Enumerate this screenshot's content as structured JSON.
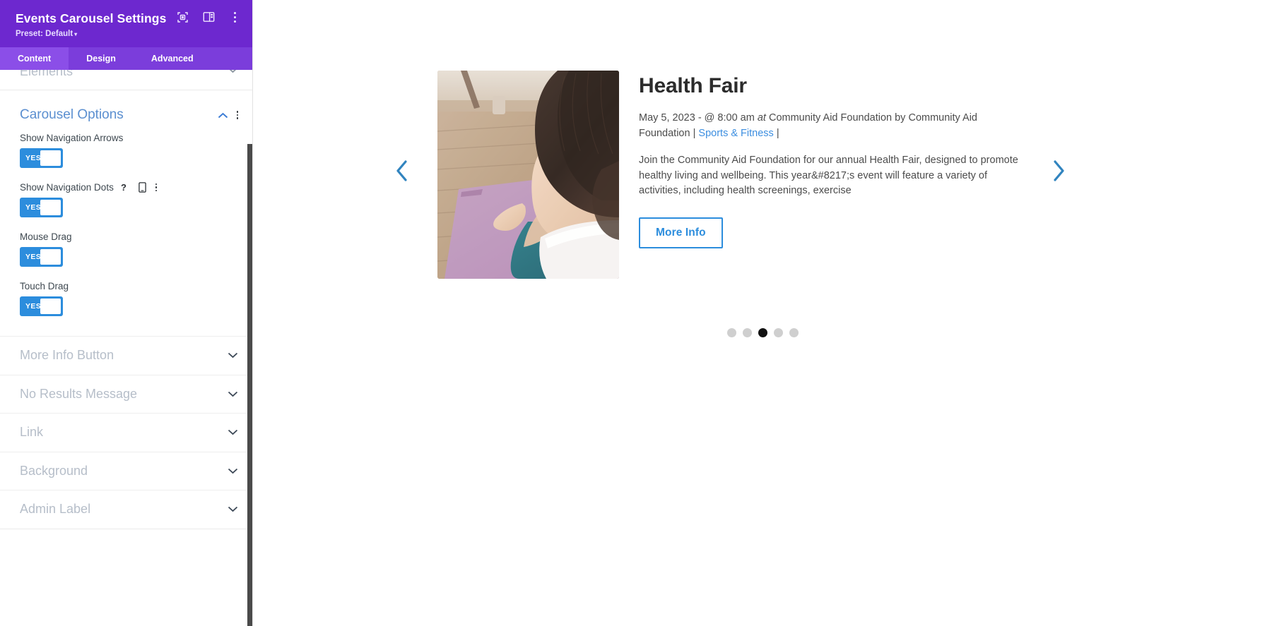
{
  "panel": {
    "title": "Events Carousel Settings",
    "preset_label": "Preset: Default",
    "preset_caret": "▾",
    "header_icons": [
      {
        "name": "focus-target-icon",
        "label": "Focus"
      },
      {
        "name": "layout-columns-icon",
        "label": "Layout"
      },
      {
        "name": "more-options-icon",
        "label": "More options"
      }
    ],
    "tabs": [
      {
        "label": "Content",
        "active": true
      },
      {
        "label": "Design",
        "active": false
      },
      {
        "label": "Advanced",
        "active": false
      }
    ],
    "partial_section_above": {
      "title": "Elements"
    },
    "open_section": {
      "title": "Carousel Options",
      "collapse_icon": "chevron-up",
      "menu_icon": "more-options",
      "fields": [
        {
          "label": "Show Navigation Arrows",
          "toggle_value": "YES",
          "icons": []
        },
        {
          "label": "Show Navigation Dots",
          "toggle_value": "YES",
          "icons": [
            "help-icon",
            "responsive-device-icon",
            "more-options-icon"
          ]
        },
        {
          "label": "Mouse Drag",
          "toggle_value": "YES",
          "icons": []
        },
        {
          "label": "Touch Drag",
          "toggle_value": "YES",
          "icons": []
        }
      ]
    },
    "collapsed_sections": [
      {
        "title": "More Info Button"
      },
      {
        "title": "No Results Message"
      },
      {
        "title": "Link"
      },
      {
        "title": "Background"
      },
      {
        "title": "Admin Label"
      }
    ],
    "colors": {
      "header_bg": "#6d28cf",
      "tabbar_bg": "#7b3ddb",
      "tab_active_bg": "#8b4ee8",
      "toggle_on": "#2c8ddd",
      "section_open_title": "#5b8fd0",
      "section_collapsed_title": "#b6bec9"
    }
  },
  "preview": {
    "event": {
      "title": "Health Fair",
      "meta": {
        "date": "May 5, 2023 - @ 8:00 am",
        "at_word": "at",
        "venue": "Community Aid Foundation",
        "by_word": "by",
        "organizer": "Community Aid Foundation",
        "separator1": "|",
        "category_link": "Sports & Fitness",
        "separator2": "|"
      },
      "description": "Join the Community Aid Foundation for our annual Health Fair, designed to promote healthy living and wellbeing. This year&#8217;s event will feature a variety of activities, including health screenings, exercise",
      "button_label": "More Info",
      "image_alt": "woman sitting cross-legged on a purple yoga mat on a wooden floor"
    },
    "nav": {
      "prev_icon": "chevron-left-icon",
      "next_icon": "chevron-right-icon",
      "dots_total": 5,
      "dots_active_index": 2
    },
    "colors": {
      "link": "#3c8ee0",
      "button_border": "#2c8ddd",
      "arrow": "#3184bf",
      "dot_active": "#111111",
      "dot_inactive": "#cfcfcf"
    }
  }
}
